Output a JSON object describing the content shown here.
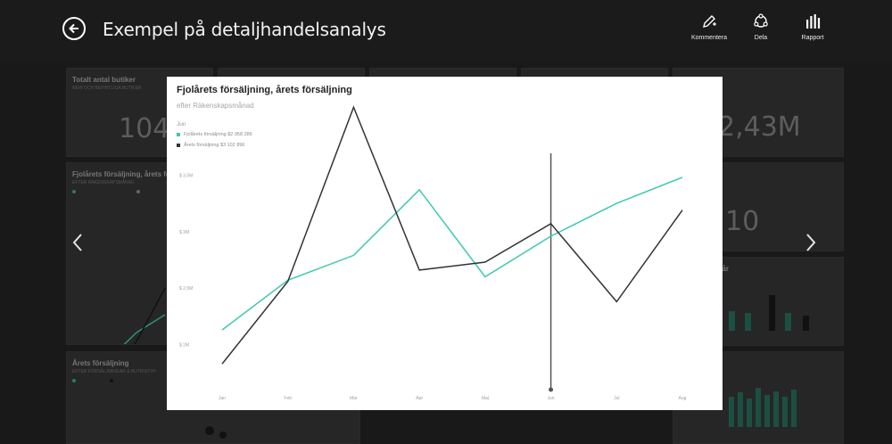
{
  "header": {
    "title": "Exempel på detaljhandelsanalys",
    "actions": [
      {
        "label": "Kommentera",
        "icon": "pen-icon"
      },
      {
        "label": "Dela",
        "icon": "share-icon"
      },
      {
        "label": "Rapport",
        "icon": "report-icon"
      }
    ]
  },
  "background_tiles": {
    "tile1_title": "Totalt antal butiker",
    "tile1_sub": "NEW OCH BEFINTLIGA BUTIKER",
    "tile1_value": "104",
    "tile4_value": "2,43M",
    "tile_mid_value": "10",
    "tile_left_chart_title": "Fjolårets försäljning, årets försäljning",
    "tile_left_chart_sub": "EFTER RÄKENSKAPSMÅNAD",
    "tile_left_map_title": "Årets försäljning",
    "tile_left_map_sub": "EFTER FÖRSÄLJNINGAR & BUTIKSTYP",
    "tile_right_chart_title": "i år"
  },
  "chart_data": {
    "type": "line",
    "title": "Fjolårets försäljning, årets försäljning",
    "subtitle": "efter Räkenskapsmånad",
    "legend_title": "Jun",
    "categories": [
      "Jan",
      "Feb",
      "Mar",
      "Apr",
      "Maj",
      "Jun",
      "Jul",
      "Aug"
    ],
    "y_ticks": [
      "$ 3,5M",
      "$ 3M",
      "$ 2,5M",
      "$ 2M"
    ],
    "y_tick_values": [
      3.5,
      3.0,
      2.5,
      2.0
    ],
    "ylim": [
      1.65,
      3.7
    ],
    "series": [
      {
        "name": "Fjolårets försäljning",
        "legend_label": "Fjolårets försäljning $2 958 286",
        "color": "#3cc9ad",
        "values": [
          2.13,
          2.57,
          2.79,
          3.37,
          2.6,
          2.96,
          3.25,
          3.48
        ]
      },
      {
        "name": "Årets försäljning",
        "legend_label": "Årets försäljning $3 102 896",
        "color": "#333333",
        "values": [
          1.83,
          2.56,
          4.1,
          2.66,
          2.73,
          3.07,
          2.38,
          3.19
        ]
      }
    ],
    "highlight_category": "Jun",
    "grid": false,
    "legend_position": "top-left"
  }
}
